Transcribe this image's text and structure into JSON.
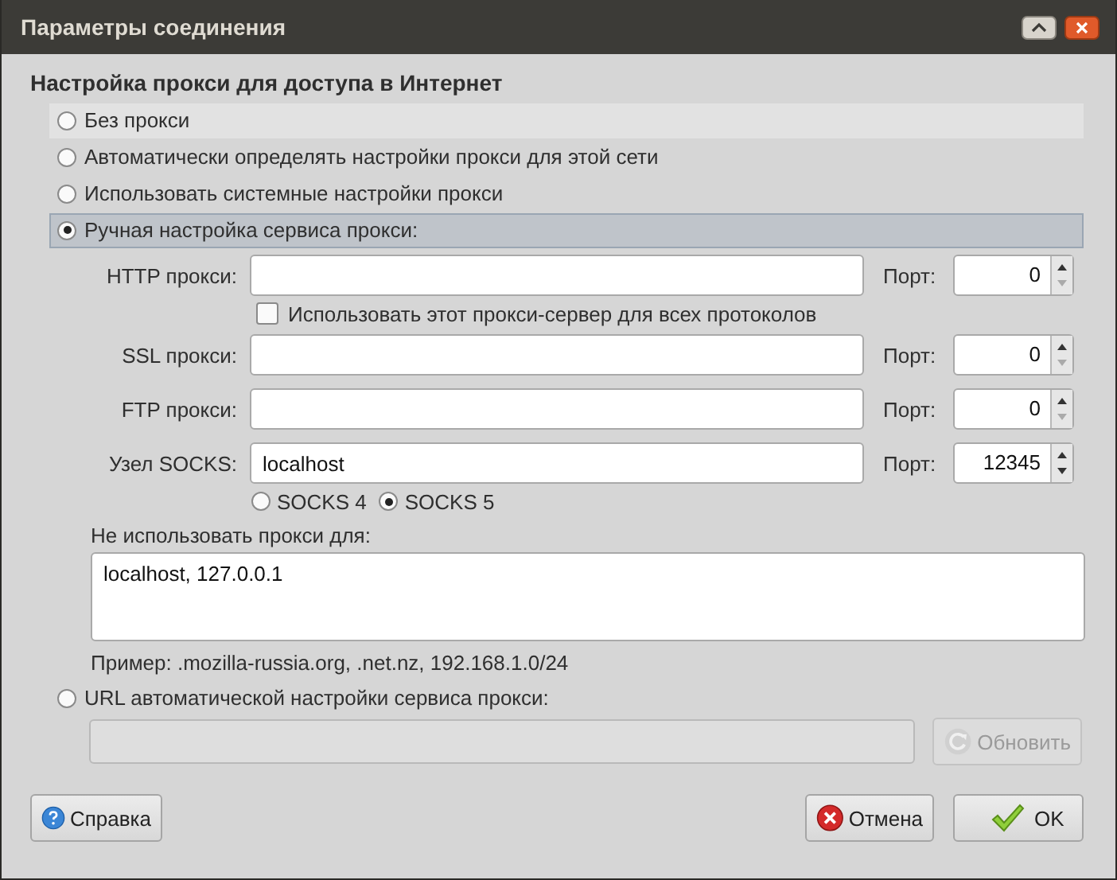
{
  "window": {
    "title": "Параметры соединения"
  },
  "heading": "Настройка прокси для доступа в Интернет",
  "proxy_modes": [
    {
      "label": "Без прокси",
      "selected": false,
      "hovered": true,
      "focused": false
    },
    {
      "label": "Автоматически определять настройки прокси для этой сети",
      "selected": false,
      "hovered": false,
      "focused": false
    },
    {
      "label": "Использовать системные настройки прокси",
      "selected": false,
      "hovered": false,
      "focused": false
    },
    {
      "label": "Ручная настройка сервиса прокси:",
      "selected": true,
      "hovered": false,
      "focused": true
    }
  ],
  "proxies": [
    {
      "label": "HTTP прокси:",
      "port_label": "Порт:",
      "port": "0"
    },
    {
      "label": "SSL прокси:",
      "port_label": "Порт:",
      "port": "0"
    },
    {
      "label": "FTP прокси:",
      "port_label": "Порт:",
      "port": "0"
    },
    {
      "label": "Узел SOCKS:",
      "value": "localhost",
      "port_label": "Порт:",
      "port": "12345"
    }
  ],
  "share_all": {
    "label": "Использовать этот прокси-сервер для всех протоколов",
    "checked": false
  },
  "socks_versions": [
    {
      "label": "SOCKS 4",
      "selected": false
    },
    {
      "label": "SOCKS 5",
      "selected": true
    }
  ],
  "no_proxy": {
    "label": "Не использовать прокси для:",
    "value": "localhost, 127.0.0.1",
    "example": "Пример: .mozilla-russia.org, .net.nz, 192.168.1.0/24"
  },
  "auto_url": {
    "label": "URL автоматической настройки сервиса прокси:",
    "selected": false,
    "disabled": true
  },
  "reload_button": {
    "label": "Обновить",
    "disabled": true
  },
  "buttons": [
    {
      "kind": "help",
      "label": "Справка"
    },
    {
      "kind": "cancel",
      "label": "Отмена"
    },
    {
      "kind": "ok",
      "label": "OK"
    }
  ]
}
